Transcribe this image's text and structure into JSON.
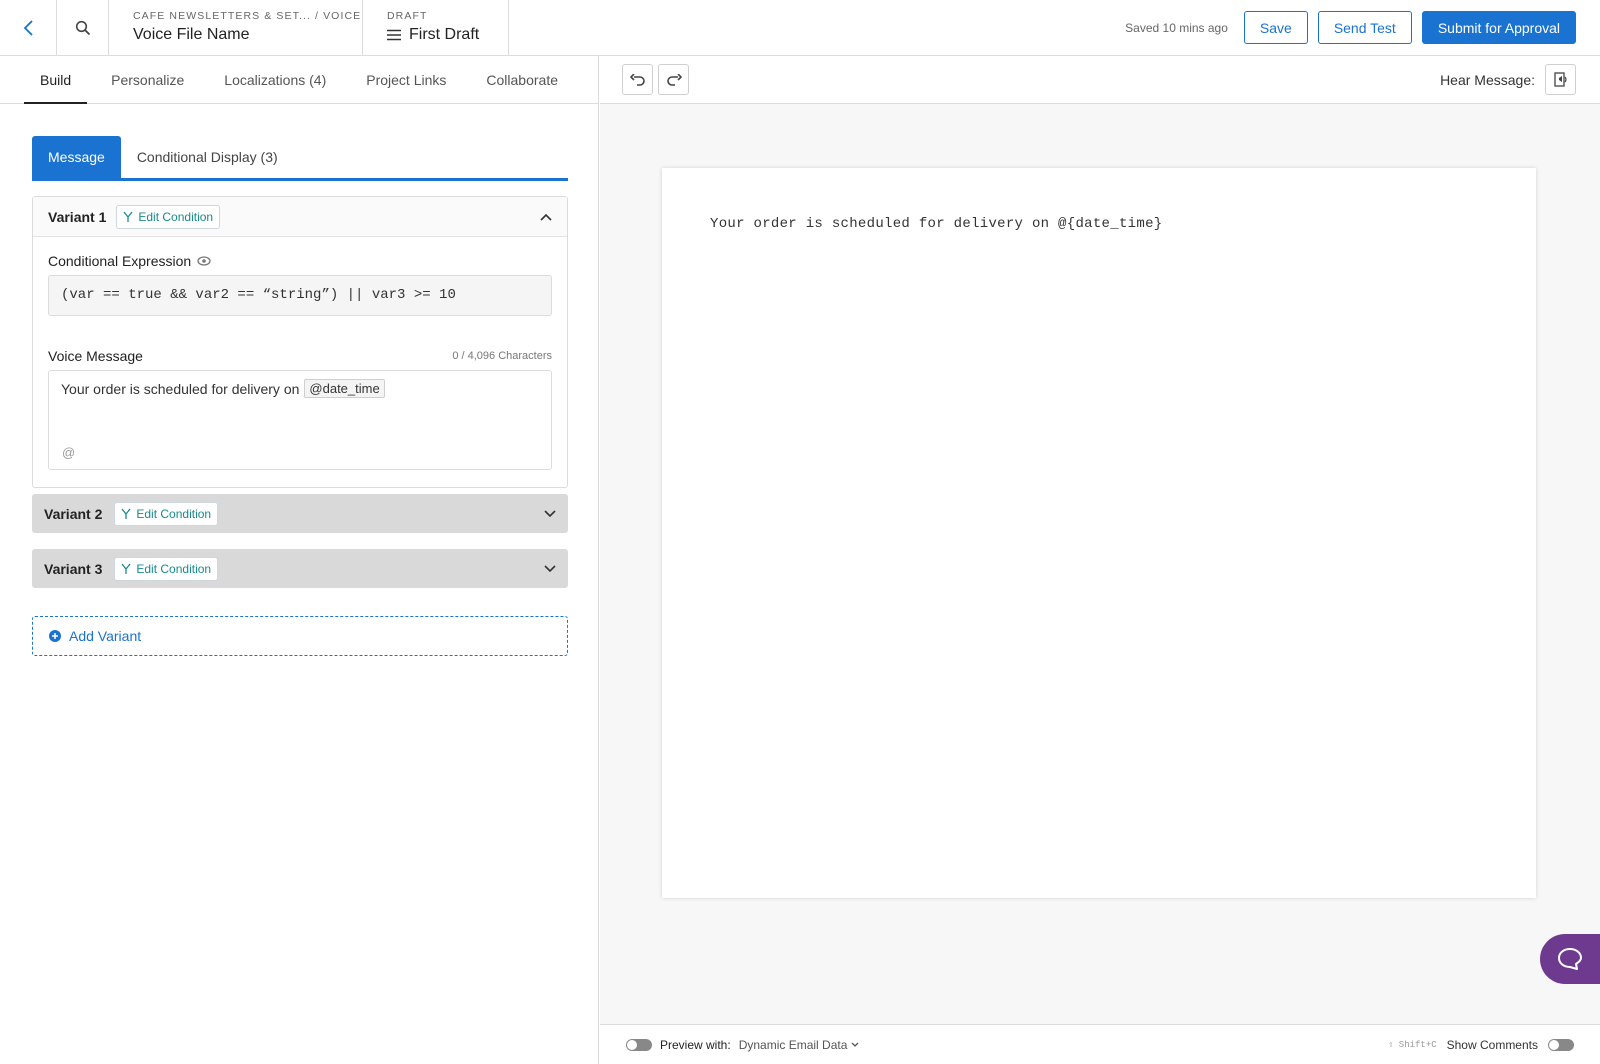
{
  "header": {
    "breadcrumb": "CAFE NEWSLETTERS & SET... / VOICE",
    "file_name": "Voice File Name",
    "status_label": "DRAFT",
    "draft_name": "First Draft",
    "saved_text": "Saved 10 mins ago",
    "save_label": "Save",
    "send_test_label": "Send Test",
    "submit_label": "Submit for Approval"
  },
  "nav_tabs": [
    {
      "label": "Build",
      "active": true
    },
    {
      "label": "Personalize",
      "active": false
    },
    {
      "label": "Localizations (4)",
      "active": false
    },
    {
      "label": "Project Links",
      "active": false
    },
    {
      "label": "Collaborate",
      "active": false
    }
  ],
  "segment_tabs": [
    {
      "label": "Message",
      "active": true
    },
    {
      "label": "Conditional Display (3)",
      "active": false
    }
  ],
  "variants": [
    {
      "title": "Variant 1",
      "edit_label": "Edit Condition",
      "expanded": true,
      "conditional_expression_label": "Conditional Expression",
      "expression": "(var == true && var2 == “string”) || var3 >= 10",
      "voice_message_label": "Voice Message",
      "char_count": "0 / 4,096 Characters",
      "message_text": "Your order is scheduled for delivery on",
      "message_variable": "@date_time",
      "insert_symbol": "@"
    },
    {
      "title": "Variant 2",
      "edit_label": "Edit Condition",
      "expanded": false
    },
    {
      "title": "Variant 3",
      "edit_label": "Edit Condition",
      "expanded": false
    }
  ],
  "add_variant_label": "Add Variant",
  "preview": {
    "hear_message_label": "Hear Message:",
    "text": "Your order is scheduled for delivery on @{date_time}"
  },
  "footer": {
    "preview_label": "Preview with:",
    "preview_value": "Dynamic Email Data",
    "shortcut": "⇧ Shift+C",
    "show_comments_label": "Show Comments"
  },
  "colors": {
    "primary": "#1a73d1",
    "teal": "#1a8a8a",
    "chat_purple": "#6e3a8f",
    "collapsed_variant_bg": "#d9d9d9"
  }
}
